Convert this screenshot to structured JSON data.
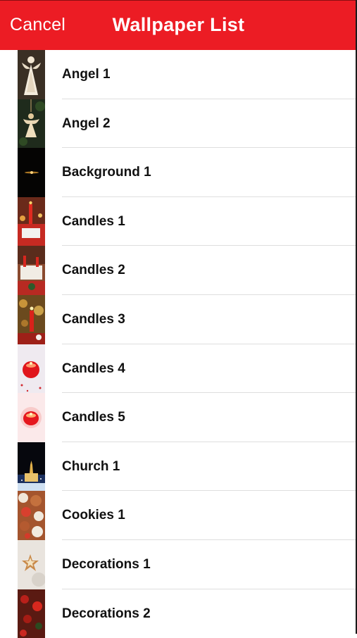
{
  "navbar": {
    "cancel_label": "Cancel",
    "title": "Wallpaper List",
    "color": "#ec1c24"
  },
  "wallpapers": [
    {
      "label": "Angel 1",
      "thumb": "angel-figurine"
    },
    {
      "label": "Angel 2",
      "thumb": "angel-ornament"
    },
    {
      "label": "Background 1",
      "thumb": "dark-sparkle"
    },
    {
      "label": "Candles 1",
      "thumb": "red-candles-table"
    },
    {
      "label": "Candles 2",
      "thumb": "candles-room"
    },
    {
      "label": "Candles 3",
      "thumb": "red-candle-bokeh"
    },
    {
      "label": "Candles 4",
      "thumb": "red-glass-candle"
    },
    {
      "label": "Candles 5",
      "thumb": "red-candle-glow"
    },
    {
      "label": "Church 1",
      "thumb": "church-night"
    },
    {
      "label": "Cookies 1",
      "thumb": "gingerbread-cookies"
    },
    {
      "label": "Decorations 1",
      "thumb": "star-ornament"
    },
    {
      "label": "Decorations 2",
      "thumb": "red-berries"
    }
  ]
}
